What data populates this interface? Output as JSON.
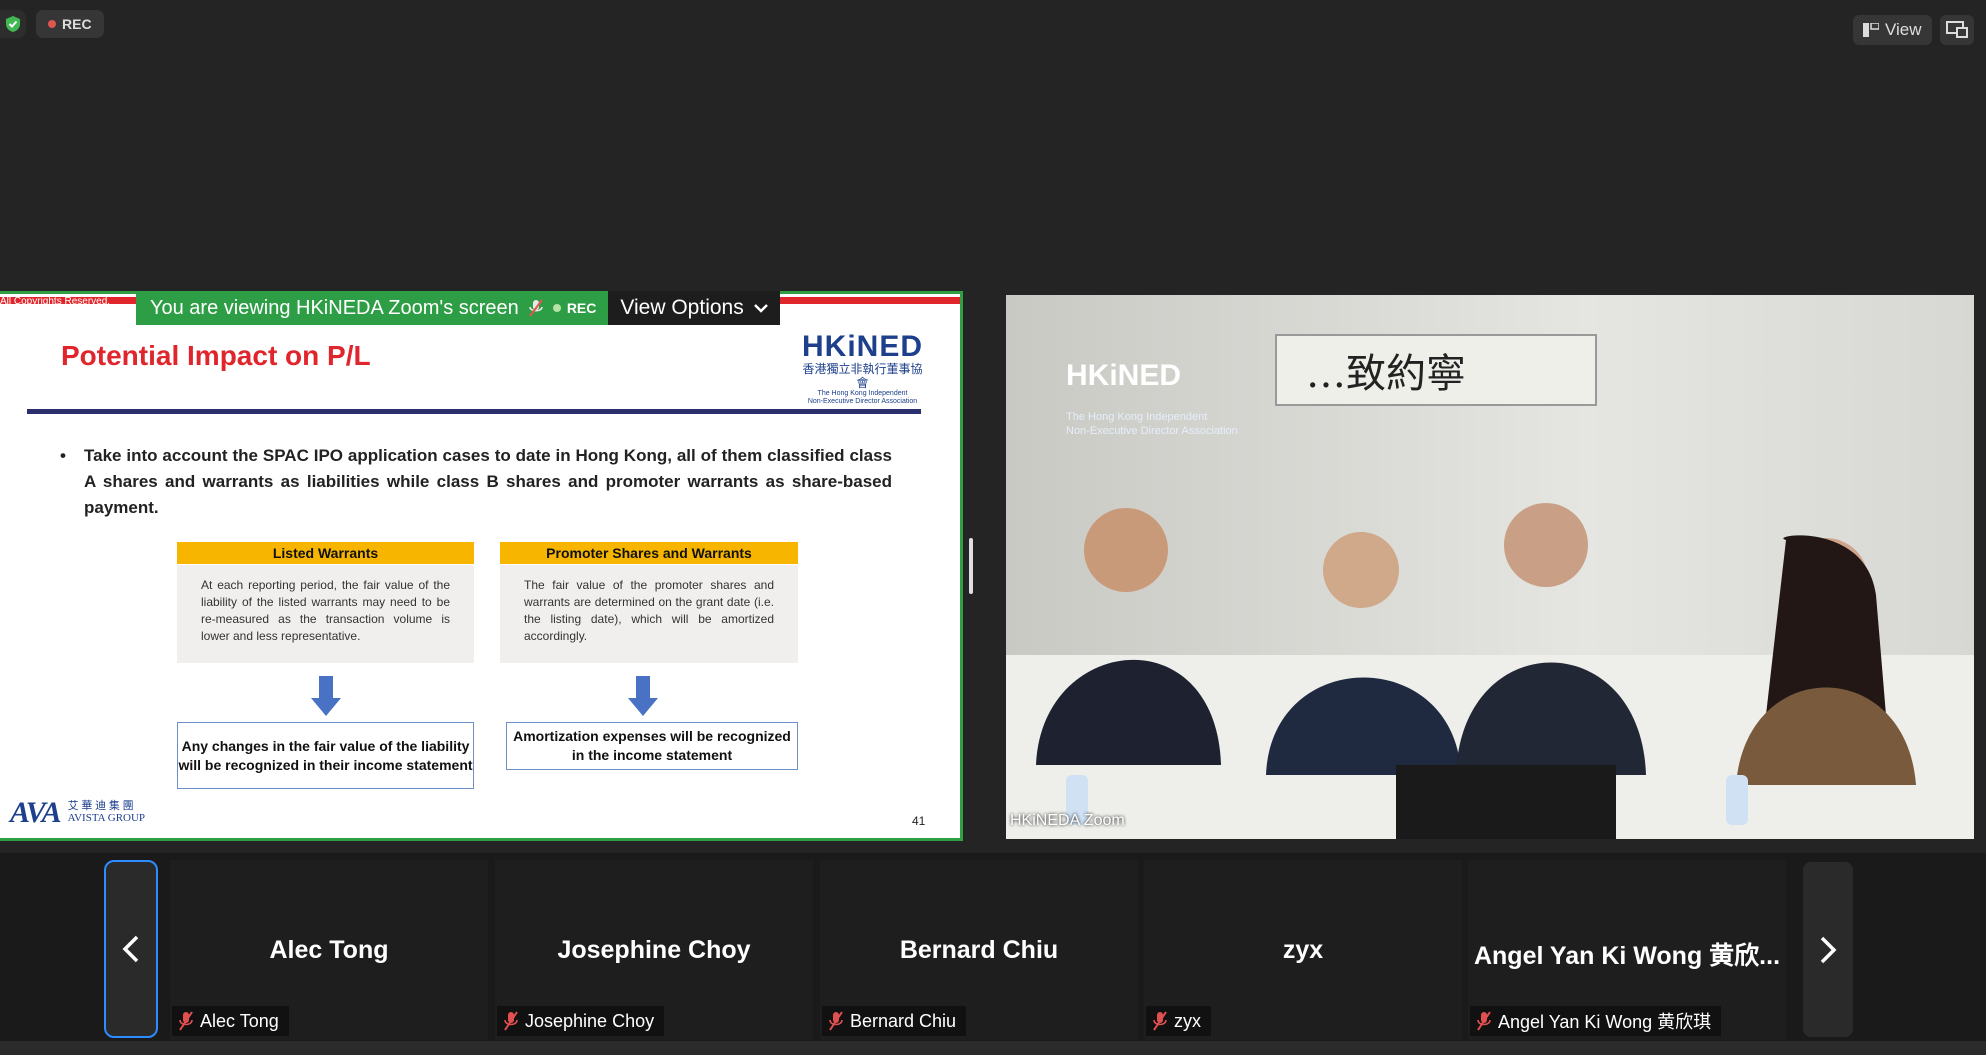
{
  "topbar": {
    "rec_label": "REC",
    "view_label": "View",
    "shield_icon": "shield-check-icon",
    "screen_icon": "screen-share-icon"
  },
  "share_banner": {
    "viewing_text": "You are viewing HKiNEDA Zoom's screen",
    "rec_label": "REC",
    "view_options_label": "View Options"
  },
  "slide": {
    "copyright": "All Copyrights Reserved.",
    "title": "Potential Impact on P/L",
    "logo": {
      "name": "HKiNED",
      "chinese": "香港獨立非執行董事協會",
      "english_line1": "The Hong Kong Independent",
      "english_line2": "Non-Executive Director Association"
    },
    "bullet": "Take into account the SPAC IPO application cases to date in Hong Kong, all of them classified class A shares and warrants as liabilities while class B shares and promoter warrants as share-based payment.",
    "left_col": {
      "header": "Listed Warrants",
      "body": "At each reporting period, the fair value of the liability of the listed warrants may need to be re-measured as the transaction volume is lower and less representative.",
      "result": "Any changes in the fair value of the liability will be recognized in their income statement"
    },
    "right_col": {
      "header": "Promoter Shares and Warrants",
      "body": "The fair value of the promoter shares and warrants are determined on the grant date (i.e. the listing date), which will be amortized accordingly.",
      "result": "Amortization expenses will be recognized in the income statement"
    },
    "footer_logo": {
      "big": "AVA",
      "chinese": "艾 華 迪 集 團",
      "english": "AVISTA GROUP"
    },
    "page_number": "41"
  },
  "video": {
    "label": "HKiNEDA Zoom",
    "banner_text": "HKiNED",
    "banner_sub1": "The Hong Kong Independent",
    "banner_sub2": "Non-Executive Director Association"
  },
  "gallery": {
    "participants": [
      {
        "display": "Alec Tong",
        "label": "Alec Tong"
      },
      {
        "display": "Josephine Choy",
        "label": "Josephine Choy"
      },
      {
        "display": "Bernard Chiu",
        "label": "Bernard Chiu"
      },
      {
        "display": "zyx",
        "label": "zyx"
      },
      {
        "display": "Angel Yan Ki Wong 黄欣...",
        "label": "Angel Yan Ki Wong 黄欣琪"
      }
    ]
  },
  "colors": {
    "background": "#242424",
    "share_border": "#2ea043",
    "slide_title": "#e0262c",
    "accent_blue": "#2d8cff",
    "muted_red": "#e0574f"
  }
}
